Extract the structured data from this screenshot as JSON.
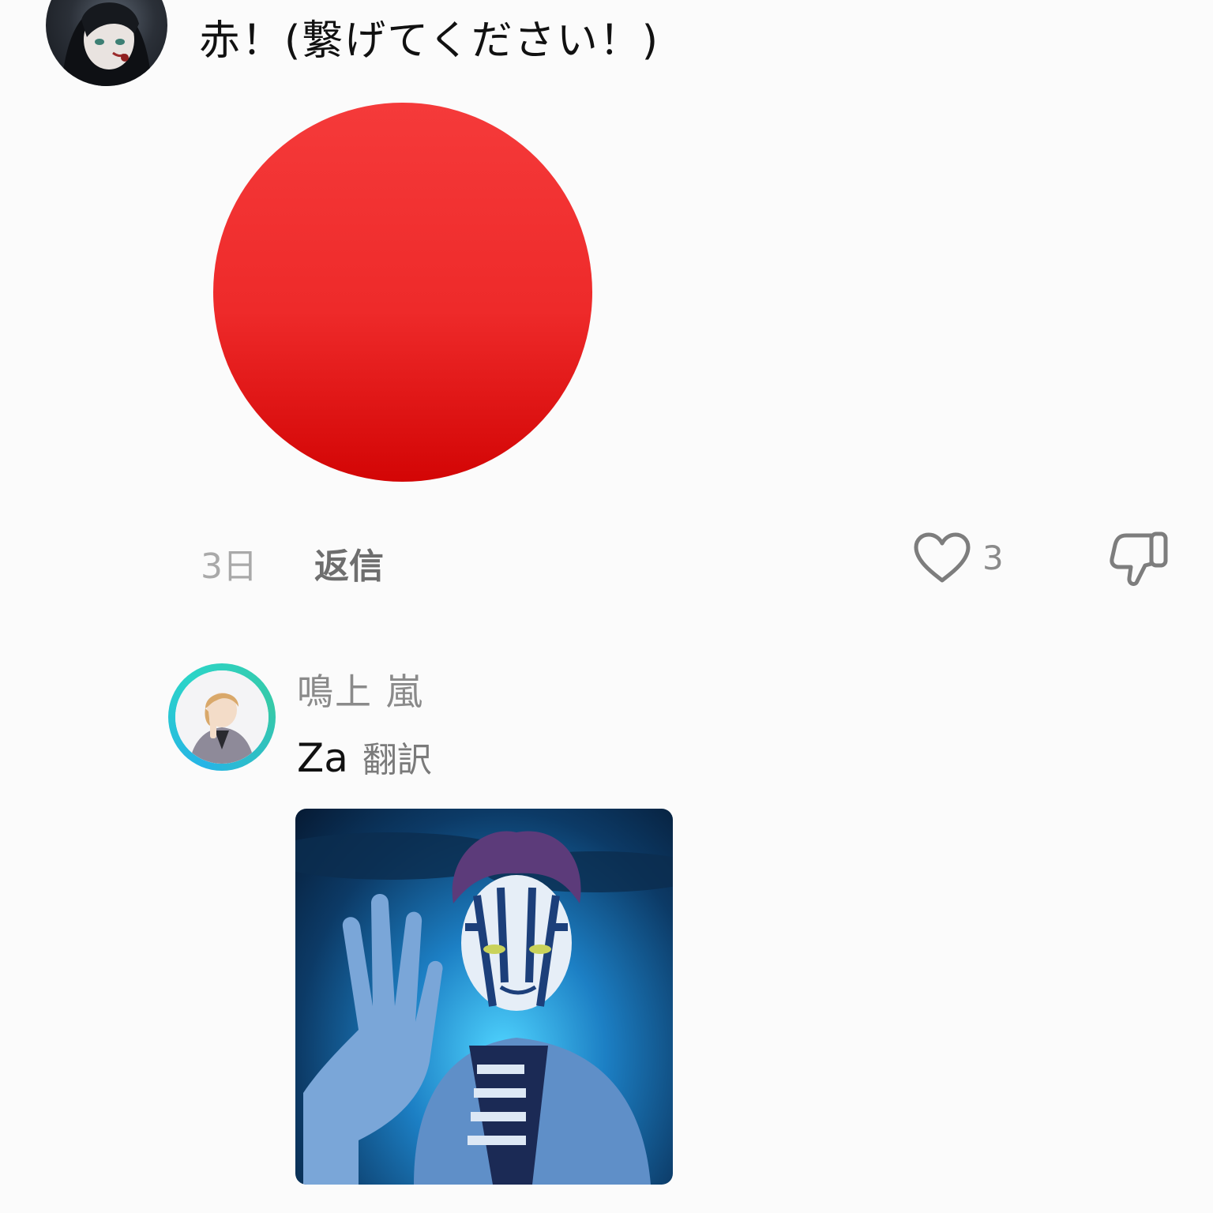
{
  "comment": {
    "avatar_icon": "user-avatar",
    "text": "赤！(繋げてください！)",
    "image_icon": "red-circle-emoji",
    "image_color": "#ee2a2a",
    "time": "3日",
    "reply_label": "返信",
    "like_icon": "heart-icon",
    "like_count": "3",
    "dislike_icon": "thumbs-down-icon"
  },
  "reply": {
    "avatar_icon": "user-avatar",
    "avatar_ring_color": "#2bc4d6",
    "author": "鳴上 嵐",
    "text": "Za",
    "translate_label": "翻訳",
    "image_icon": "anime-character-image"
  }
}
